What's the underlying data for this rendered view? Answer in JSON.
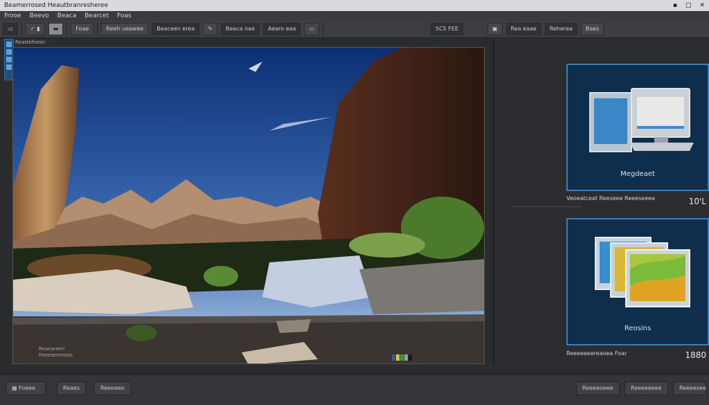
{
  "window": {
    "title": "Beamerrosed Heautbranresheree"
  },
  "menu": [
    "Frooe",
    "Beevo",
    "Beaca",
    "Bearcet",
    "Foas"
  ],
  "toolbar": {
    "btn_text_1": "Foae",
    "btn_text_2": "Reeh ueawee",
    "btn_text_3": "Beaceen erea",
    "btn_text_4": "Beaca nae",
    "btn_text_5": "Aearo eaa",
    "btn_text_6": "SCS FEE",
    "btn_text_7": "Rea eaae",
    "btn_text_8": "Reherea",
    "btn_text_9": "Baes"
  },
  "viewer": {
    "corner_label": "Reastefnesn",
    "status_line_1": "Reaeareen",
    "status_line_2": "Feeeaereeeas"
  },
  "cards": [
    {
      "label": "Megdeaet",
      "info": "Veoeatceat  Reeseee Reeeseeea",
      "num": "10'L"
    },
    {
      "label": "Reosins",
      "info": "Reeeeeeereaoea Foar",
      "num": "1880"
    }
  ],
  "bottom": {
    "left_btn": "Foeee",
    "btn_2": "Reaes",
    "btn_3": "Reeoeeo",
    "btn_4": "Reeeeoeee",
    "btn_5": "Reeeeeeee",
    "btn_6": "Reeeesee"
  },
  "colors": {
    "accent": "#3c7fb8",
    "card_bg": "#0f2d4d",
    "chrome": "#3c3e41"
  }
}
